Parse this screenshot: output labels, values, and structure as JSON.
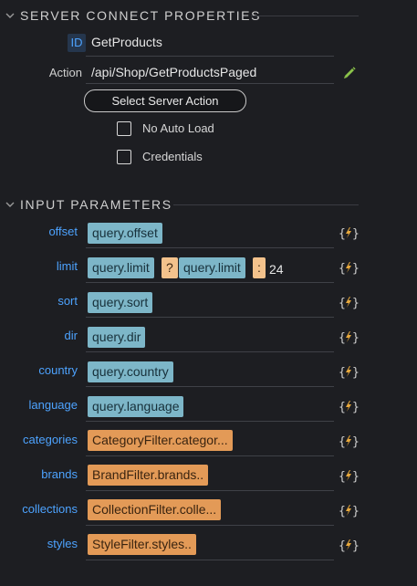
{
  "server_connect": {
    "title": "SERVER CONNECT PROPERTIES",
    "id_label": "ID",
    "id_value": "GetProducts",
    "action_label": "Action",
    "action_value": "/api/Shop/GetProductsPaged",
    "select_action_label": "Select Server Action",
    "no_auto_load_label": "No Auto Load",
    "credentials_label": "Credentials"
  },
  "input_parameters": {
    "title": "INPUT PARAMETERS",
    "offset": {
      "label": "offset",
      "value": "query.offset"
    },
    "limit": {
      "label": "limit",
      "value1": "query.limit",
      "op1": "?",
      "value2": "query.limit",
      "op2": ":",
      "value3": "24"
    },
    "sort": {
      "label": "sort",
      "value": "query.sort"
    },
    "dir": {
      "label": "dir",
      "value": "query.dir"
    },
    "country": {
      "label": "country",
      "value": "query.country"
    },
    "language": {
      "label": "language",
      "value": "query.language"
    },
    "categories": {
      "label": "categories",
      "value": "CategoryFilter.categor..."
    },
    "brands": {
      "label": "brands",
      "value": "BrandFilter.brands.."
    },
    "collections": {
      "label": "collections",
      "value": "CollectionFilter.colle..."
    },
    "styles": {
      "label": "styles",
      "value": "StyleFilter.styles.."
    }
  },
  "icons": {
    "expand": "chevron-down-icon",
    "edit": "pencil-icon",
    "dynamic": "dynamic-data-icon"
  },
  "colors": {
    "accent": "#4da3ff",
    "chip_query": "#7db6c8",
    "chip_filter": "#e39a57",
    "chip_operator": "#f3c28c",
    "bolt": "#e7a83c"
  }
}
